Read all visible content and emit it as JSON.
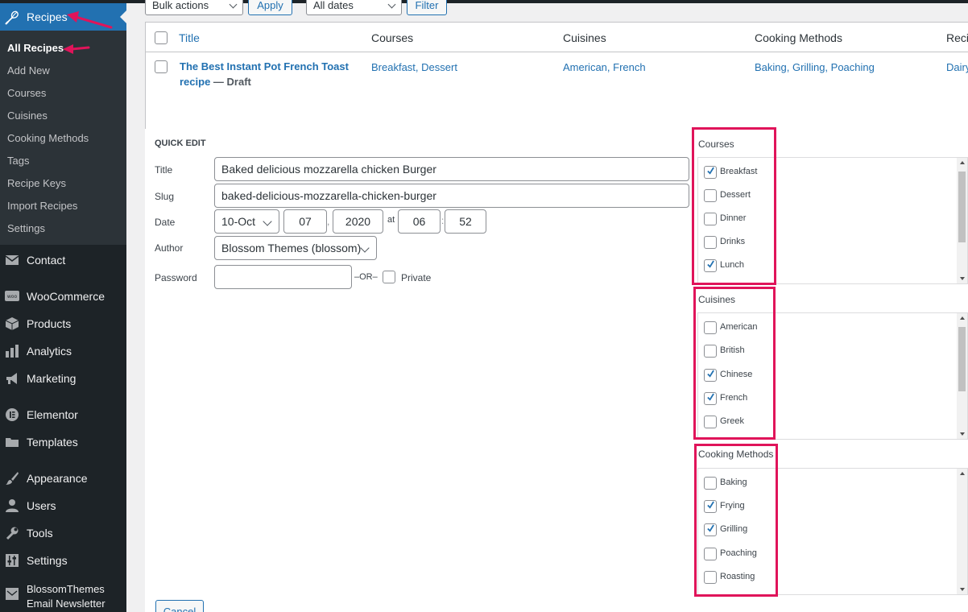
{
  "sidebar": {
    "recipes_label": "Recipes",
    "submenu": [
      "All Recipes",
      "Add New",
      "Courses",
      "Cuisines",
      "Cooking Methods",
      "Tags",
      "Recipe Keys",
      "Import Recipes",
      "Settings"
    ],
    "menu": [
      "Contact",
      "WooCommerce",
      "Products",
      "Analytics",
      "Marketing",
      "Elementor",
      "Templates",
      "Appearance",
      "Users",
      "Tools",
      "Settings"
    ],
    "newsletter_line1": "BlossomThemes",
    "newsletter_line2": "Email Newsletter"
  },
  "toolbar": {
    "bulk_actions": "Bulk actions",
    "apply": "Apply",
    "dates": "All dates",
    "filter": "Filter"
  },
  "table": {
    "headers": [
      "Title",
      "Courses",
      "Cuisines",
      "Cooking Methods",
      "Recip"
    ],
    "row": {
      "title_line1": "The Best Instant Pot French Toast",
      "title_line2": "recipe",
      "status": " — Draft",
      "courses": "Breakfast, Dessert",
      "cuisines": "American, French",
      "methods": "Baking, Grilling, Poaching",
      "keys": "Dairy"
    }
  },
  "quick_edit": {
    "heading": "QUICK EDIT",
    "title_label": "Title",
    "title_value": "Baked delicious mozzarella chicken Burger",
    "slug_label": "Slug",
    "slug_value": "baked-delicious-mozzarella-chicken-burger",
    "date_label": "Date",
    "month": "10-Oct",
    "day": "07",
    "comma": ",",
    "year": "2020",
    "at": "at",
    "hour": "06",
    "colon": ":",
    "minute": "52",
    "author_label": "Author",
    "author_value": "Blossom Themes (blossom)",
    "password_label": "Password",
    "or": "–OR–",
    "private": "Private",
    "cancel": "Cancel"
  },
  "taxonomies": {
    "courses": {
      "title": "Courses",
      "items": [
        {
          "label": "Breakfast",
          "checked": true
        },
        {
          "label": "Dessert",
          "checked": false
        },
        {
          "label": "Dinner",
          "checked": false
        },
        {
          "label": "Drinks",
          "checked": false
        },
        {
          "label": "Lunch",
          "checked": true
        }
      ]
    },
    "cuisines": {
      "title": "Cuisines",
      "items": [
        {
          "label": "American",
          "checked": false
        },
        {
          "label": "British",
          "checked": false
        },
        {
          "label": "Chinese",
          "checked": true
        },
        {
          "label": "French",
          "checked": true
        },
        {
          "label": "Greek",
          "checked": false
        }
      ]
    },
    "methods": {
      "title": "Cooking Methods",
      "items": [
        {
          "label": "Baking",
          "checked": false
        },
        {
          "label": "Frying",
          "checked": true
        },
        {
          "label": "Grilling",
          "checked": true
        },
        {
          "label": "Poaching",
          "checked": false
        },
        {
          "label": "Roasting",
          "checked": false
        }
      ]
    }
  },
  "colors": {
    "sidebar_bg": "#1d2327",
    "accent": "#2271b1",
    "highlight": "#e0145a"
  }
}
